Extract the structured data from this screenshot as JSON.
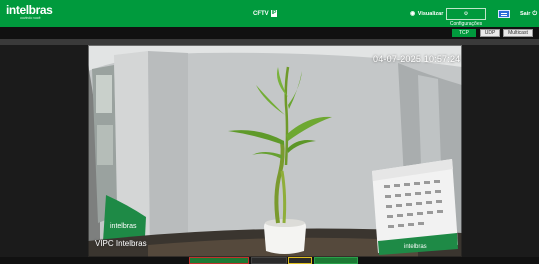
{
  "header": {
    "brand": "intelbras",
    "brand_tagline": "ouvindo você",
    "product": "CFTV",
    "product_badge": "IP",
    "view_label": "Visualizar",
    "config_label": "Configurações",
    "logout_label": "Sair"
  },
  "stream": {
    "protocols": [
      "TCP",
      "UDP",
      "Multicast"
    ],
    "selected": "TCP"
  },
  "video": {
    "osd_datetime": "04-07-2025 10:57:24",
    "osd_channel_name": "VIPC Intelbras",
    "flag_text": "intelbras",
    "calendar_brand": "intelbras"
  },
  "colors": {
    "brand_green": "#009a3d",
    "accent_blue": "#2b6cd8"
  },
  "icons": {
    "view": "eye-icon",
    "config": "gear-icon",
    "tile": "layout-icon",
    "logout": "power-icon"
  }
}
